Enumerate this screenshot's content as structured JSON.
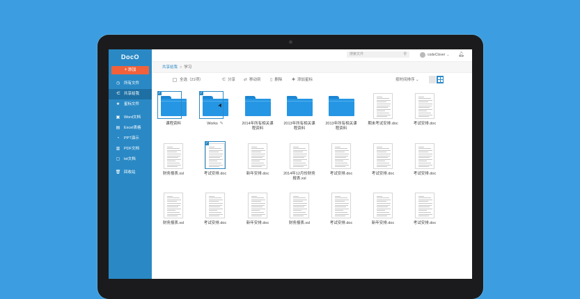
{
  "app": {
    "logo": "DocO",
    "add_label": "添加"
  },
  "sidebar": {
    "items": [
      {
        "label": "所有文件",
        "icon": "clock-icon",
        "glyph": "◷"
      },
      {
        "label": "共享给我",
        "icon": "share-icon",
        "glyph": "⋲",
        "active": true
      },
      {
        "label": "星标文件",
        "icon": "star-icon",
        "glyph": "★"
      },
      {
        "label": "Word文档",
        "icon": "word-icon",
        "glyph": "▣"
      },
      {
        "label": "Excel表格",
        "icon": "excel-icon",
        "glyph": "▤"
      },
      {
        "label": "PPT演示",
        "icon": "ppt-icon",
        "glyph": "◔"
      },
      {
        "label": "PDF文档",
        "icon": "pdf-icon",
        "glyph": "▥"
      },
      {
        "label": "txt文档",
        "icon": "txt-icon",
        "glyph": "▢"
      },
      {
        "label": "回收站",
        "icon": "trash-icon",
        "glyph": "🗑"
      }
    ]
  },
  "header": {
    "search_placeholder": "搜索文件",
    "username": "codeClover"
  },
  "breadcrumb": {
    "root": "共享给我",
    "separator": ">",
    "current": "学习"
  },
  "toolbar": {
    "select_all": "全选（21项）",
    "share": "分享",
    "move": "移动到",
    "delete": "删除",
    "star": "添加星标",
    "sort": "按时间排序"
  },
  "files": [
    {
      "name": "课程资料",
      "type": "folder",
      "selected": true
    },
    {
      "name": "Works",
      "type": "folder",
      "selected": true,
      "editing": true
    },
    {
      "name": "2014年所有相关课程资料",
      "type": "folder"
    },
    {
      "name": "2013年所有相关课程资料",
      "type": "folder"
    },
    {
      "name": "2013年所有相关课程资料",
      "type": "folder"
    },
    {
      "name": "期末考试安排.doc",
      "type": "doc"
    },
    {
      "name": "考试安排.doc",
      "type": "doc"
    },
    {
      "name": "财务报表.xsl",
      "type": "doc"
    },
    {
      "name": "考试安排.doc",
      "type": "doc",
      "selected": true
    },
    {
      "name": "新年安排.doc",
      "type": "doc"
    },
    {
      "name": "2014年12月份财务报表.xsl",
      "type": "doc"
    },
    {
      "name": "考试安排.doc",
      "type": "doc"
    },
    {
      "name": "考试安排.doc",
      "type": "doc"
    },
    {
      "name": "考试安排.doc",
      "type": "doc"
    },
    {
      "name": "财务报表.xsl",
      "type": "doc"
    },
    {
      "name": "考试安排.doc",
      "type": "doc"
    },
    {
      "name": "新年安排.doc",
      "type": "doc"
    },
    {
      "name": "财务报表.xsl",
      "type": "doc"
    },
    {
      "name": "考试安排.doc",
      "type": "doc"
    },
    {
      "name": "新年安排.doc",
      "type": "doc"
    },
    {
      "name": "考试安排.doc",
      "type": "doc"
    }
  ],
  "colors": {
    "background": "#3c9ee0",
    "sidebar": "#2a89c5",
    "accent": "#f1613b",
    "folder": "#2596e3"
  }
}
